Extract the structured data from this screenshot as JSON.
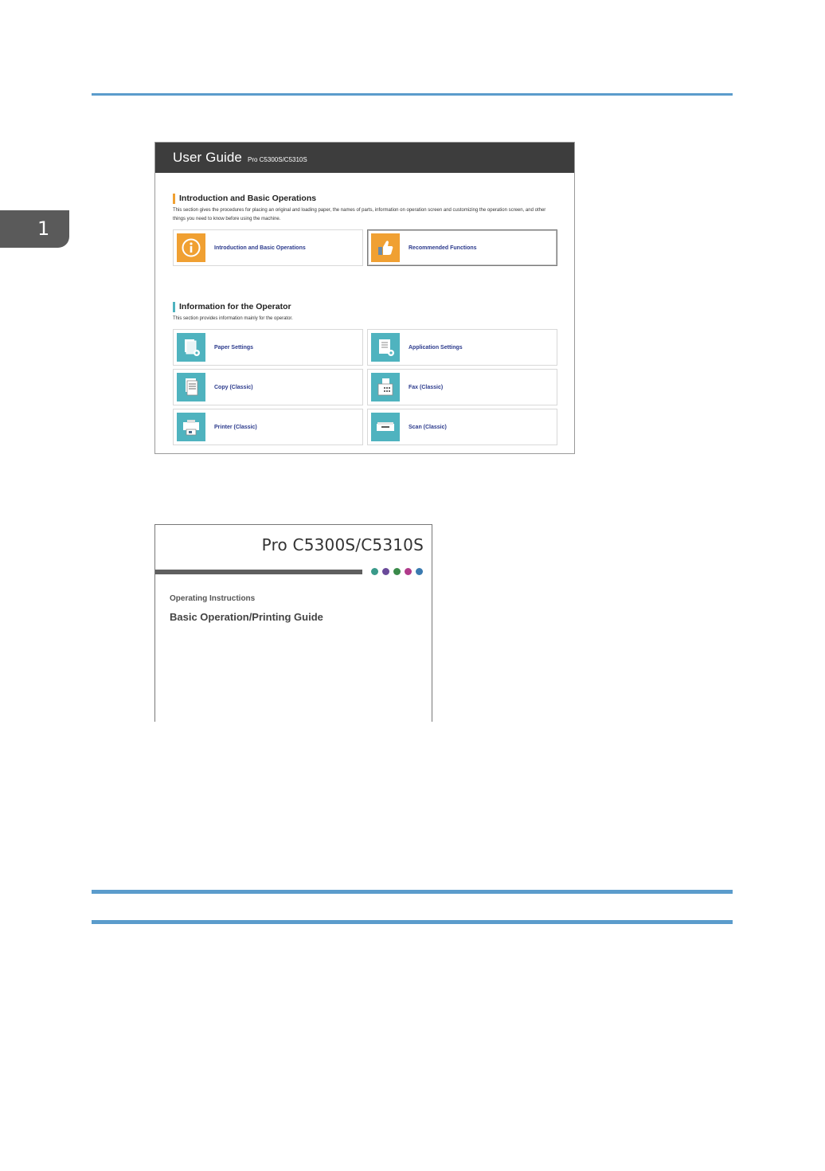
{
  "chapter": {
    "number": "1"
  },
  "colors": {
    "rule": "#5b9ccc",
    "accent_orange": "#f0a032",
    "accent_teal": "#4fb3bf",
    "header_dark": "#3d3d3d",
    "link_blue": "#2b3a8c"
  },
  "user_guide": {
    "title": "User Guide",
    "model": "Pro C5300S/C5310S",
    "sections": [
      {
        "heading": "Introduction and Basic Operations",
        "description": "This section gives the procedures for placing an original and loading paper, the names of parts, information on operation screen and customizing the operation screen, and other things you need to know before using the machine.",
        "cards": [
          {
            "label": "Introduction and Basic Operations",
            "icon": "info-icon"
          },
          {
            "label": "Recommended Functions",
            "icon": "thumbs-up-icon"
          }
        ]
      },
      {
        "heading": "Information for the Operator",
        "description": "This section provides information mainly for the operator.",
        "cards": [
          {
            "label": "Paper Settings",
            "icon": "paper-settings-icon"
          },
          {
            "label": "Application Settings",
            "icon": "application-settings-icon"
          },
          {
            "label": "Copy (Classic)",
            "icon": "copy-icon"
          },
          {
            "label": "Fax (Classic)",
            "icon": "fax-icon"
          },
          {
            "label": "Printer (Classic)",
            "icon": "printer-icon"
          },
          {
            "label": "Scan (Classic)",
            "icon": "scanner-icon"
          }
        ]
      }
    ]
  },
  "cover": {
    "model": "Pro C5300S/C5310S",
    "subtitle": "Operating Instructions",
    "title": "Basic Operation/Printing Guide",
    "dot_colors": [
      "#3a9a8a",
      "#6a4a9a",
      "#3a8a4a",
      "#b03a8a",
      "#3a7ab0"
    ]
  }
}
